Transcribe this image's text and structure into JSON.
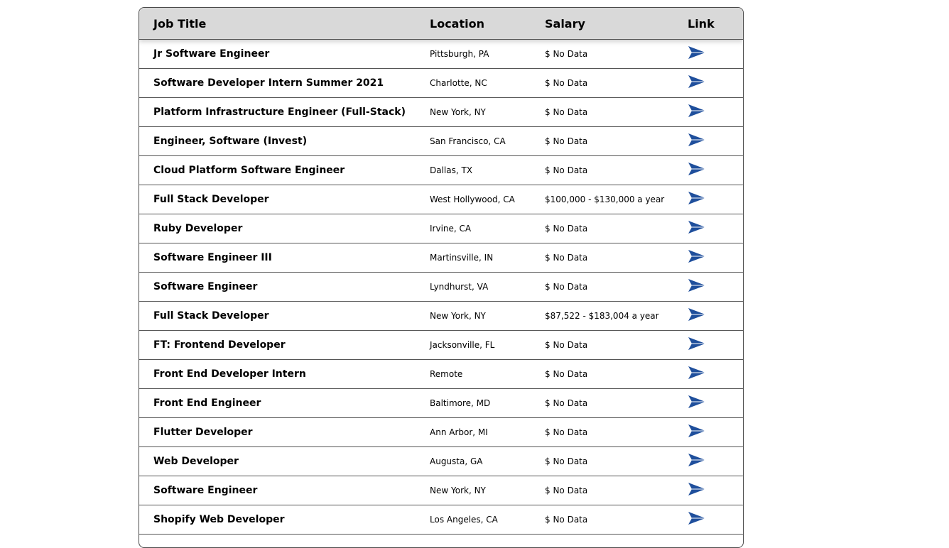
{
  "table": {
    "headers": {
      "title": "Job Title",
      "location": "Location",
      "salary": "Salary",
      "link": "Link"
    },
    "link_icon": "send-arrow-icon",
    "accent_color": "#1f4f9c",
    "rows": [
      {
        "title": "Jr Software Engineer",
        "location": "Pittsburgh, PA",
        "salary": "$ No Data"
      },
      {
        "title": "Software Developer Intern Summer 2021",
        "location": "Charlotte, NC",
        "salary": "$ No Data"
      },
      {
        "title": "Platform Infrastructure Engineer (Full-Stack)",
        "location": "New York, NY",
        "salary": "$ No Data"
      },
      {
        "title": "Engineer, Software (Invest)",
        "location": "San Francisco, CA",
        "salary": "$ No Data"
      },
      {
        "title": "Cloud Platform Software Engineer",
        "location": "Dallas, TX",
        "salary": "$ No Data"
      },
      {
        "title": "Full Stack Developer",
        "location": "West Hollywood, CA",
        "salary": "$100,000 - $130,000 a year"
      },
      {
        "title": "Ruby Developer",
        "location": "Irvine, CA",
        "salary": "$ No Data"
      },
      {
        "title": "Software Engineer III",
        "location": "Martinsville, IN",
        "salary": "$ No Data"
      },
      {
        "title": "Software Engineer",
        "location": "Lyndhurst, VA",
        "salary": "$ No Data"
      },
      {
        "title": "Full Stack Developer",
        "location": "New York, NY",
        "salary": "$87,522 - $183,004 a year"
      },
      {
        "title": "FT: Frontend Developer",
        "location": "Jacksonville, FL",
        "salary": "$ No Data"
      },
      {
        "title": "Front End Developer Intern",
        "location": "Remote",
        "salary": "$ No Data"
      },
      {
        "title": "Front End Engineer",
        "location": "Baltimore, MD",
        "salary": "$ No Data"
      },
      {
        "title": "Flutter Developer",
        "location": "Ann Arbor, MI",
        "salary": "$ No Data"
      },
      {
        "title": "Web Developer",
        "location": "Augusta, GA",
        "salary": "$ No Data"
      },
      {
        "title": "Software Engineer",
        "location": "New York, NY",
        "salary": "$ No Data"
      },
      {
        "title": "Shopify Web Developer",
        "location": "Los Angeles, CA",
        "salary": "$ No Data"
      }
    ]
  }
}
